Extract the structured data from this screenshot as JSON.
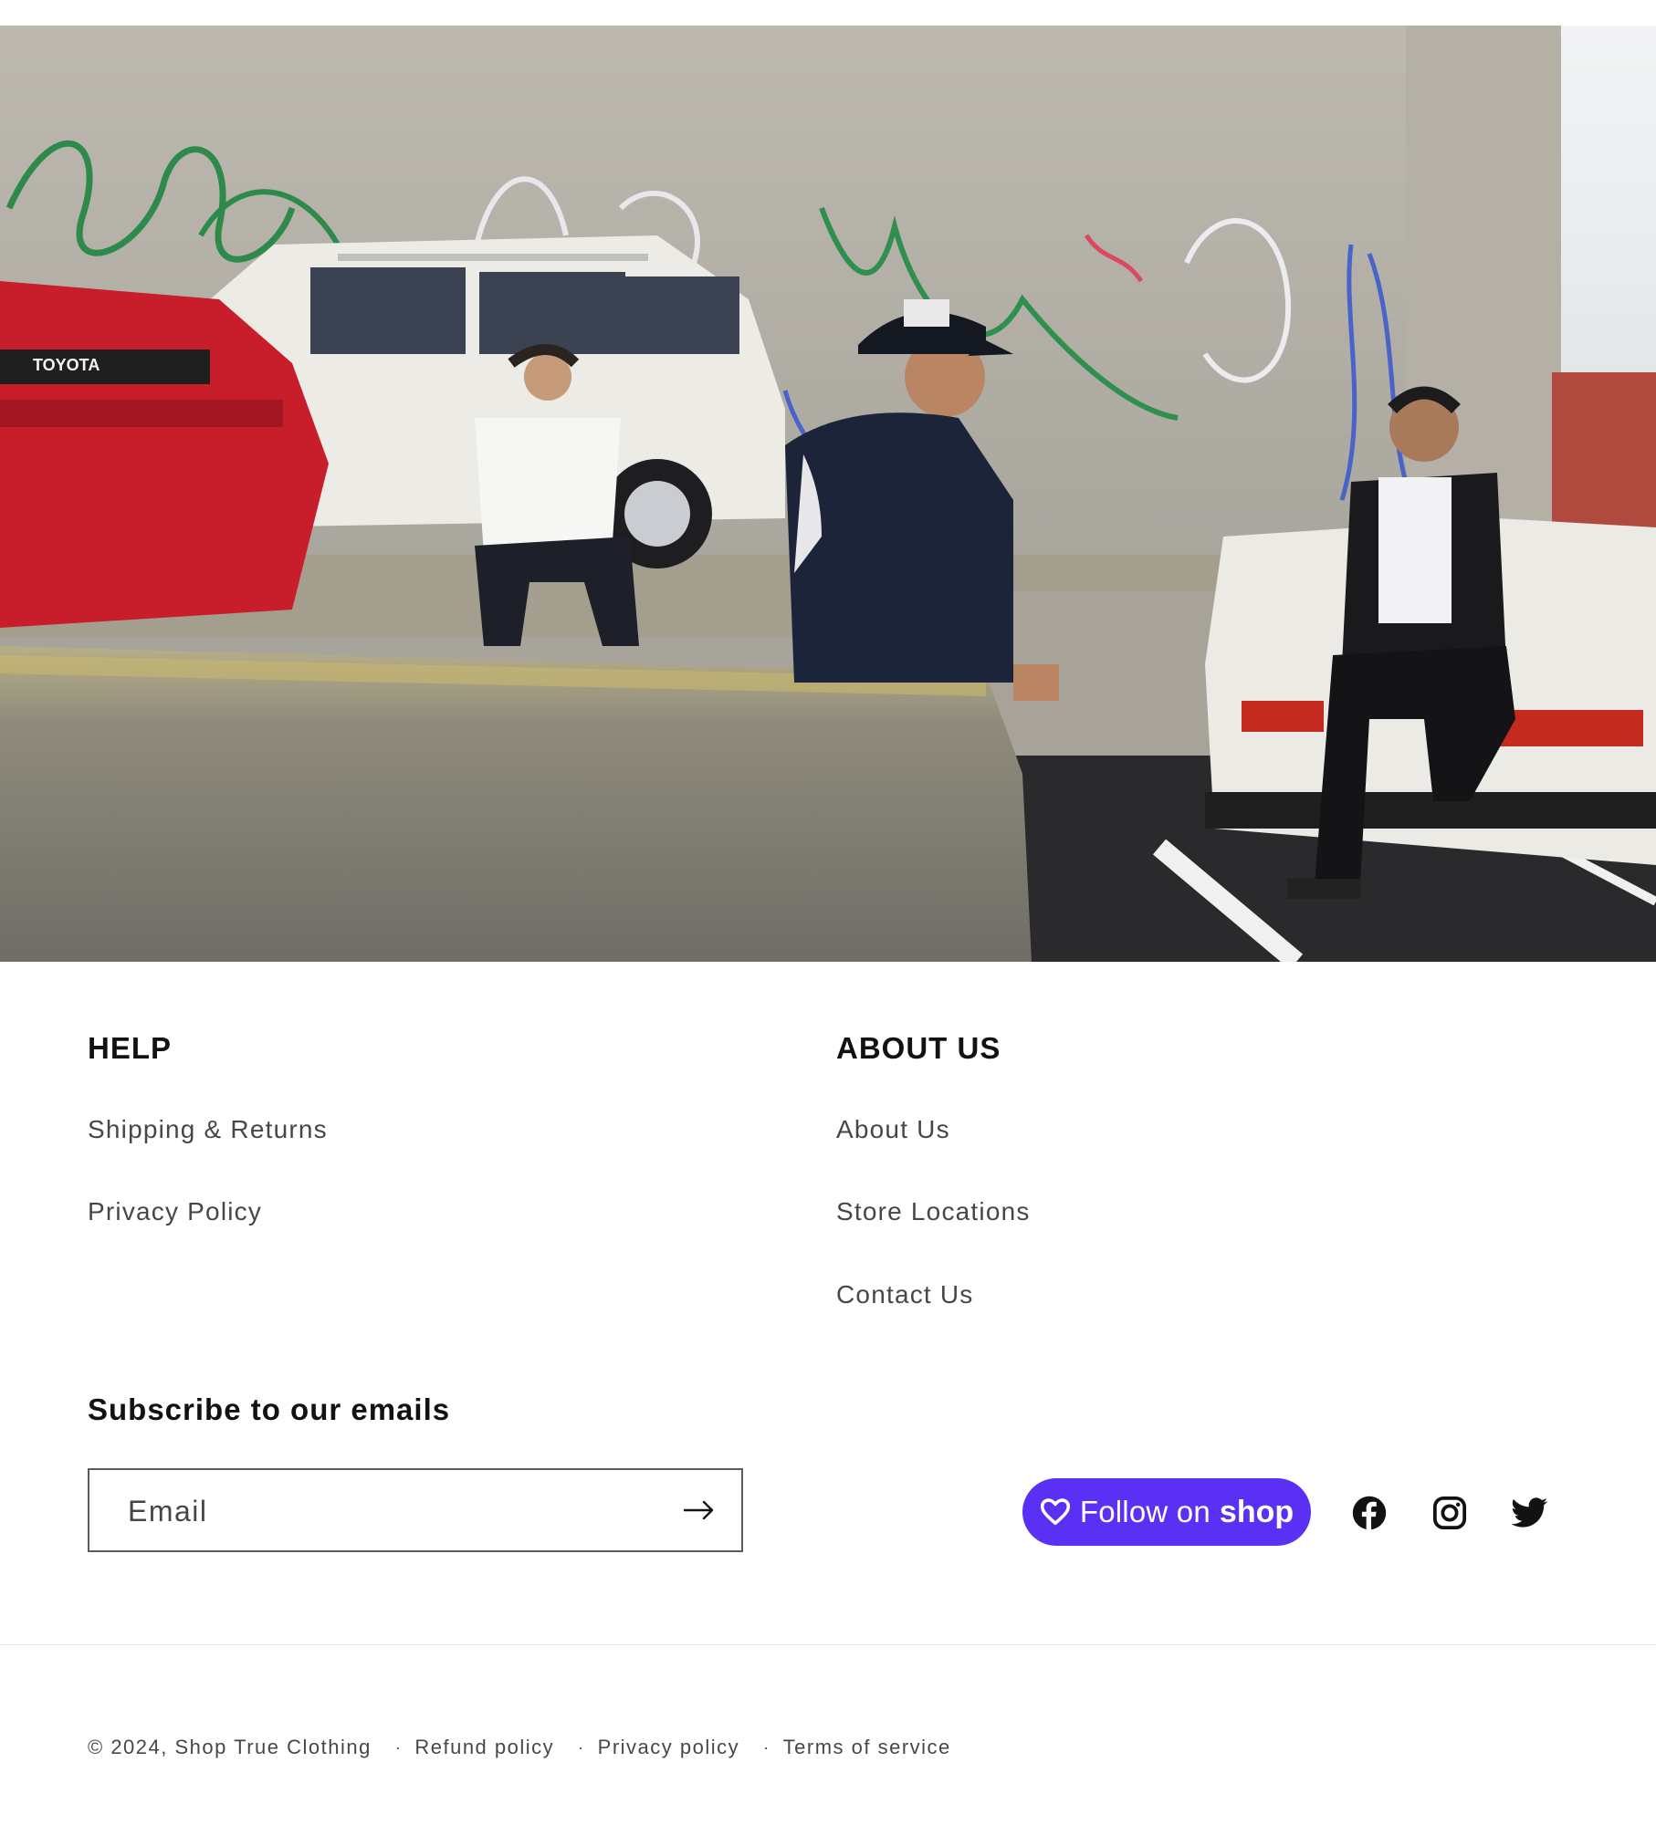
{
  "hero": {
    "photo_subject": "Three men posing with vintage Toyota cars in front of a graffiti-covered concrete wall",
    "car_badge": "TOYOTA"
  },
  "footer": {
    "help": {
      "heading": "HELP",
      "links": [
        "Shipping & Returns",
        "Privacy Policy"
      ]
    },
    "about": {
      "heading": "ABOUT US",
      "links": [
        "About Us",
        "Store Locations",
        "Contact Us"
      ]
    },
    "newsletter": {
      "heading": "Subscribe to our emails",
      "email_placeholder": "Email",
      "submit_icon": "arrow-right-icon"
    },
    "shop_button": {
      "label": "Follow on",
      "brand": "shop",
      "icon": "heart-icon",
      "color": "#5a31f4"
    },
    "social": [
      "facebook-icon",
      "instagram-icon",
      "twitter-icon"
    ],
    "copyright": "© 2024, Shop True Clothing",
    "policies": [
      "Refund policy",
      "Privacy policy",
      "Terms of service"
    ]
  }
}
